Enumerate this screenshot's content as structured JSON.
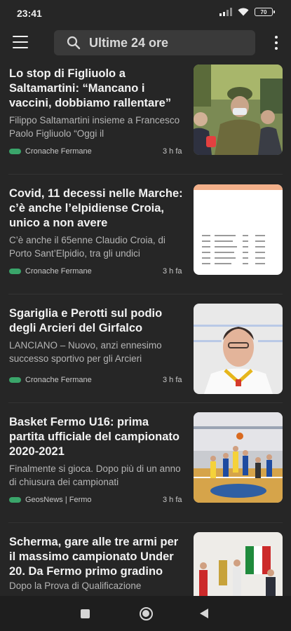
{
  "status_bar": {
    "time": "23:41",
    "battery": "70"
  },
  "search": {
    "text": "Ultime 24 ore"
  },
  "articles": [
    {
      "title": "Lo stop di Figliuolo a Saltamartini: “Mancano i vaccini, dobbiamo rallentare”",
      "snippet": "  Filippo Saltamartini insieme a Francesco Paolo Figliuolo   “Oggi il",
      "source": "Cronache Fermane",
      "time": "3 h fa"
    },
    {
      "title": "Covid, 11 decessi nelle Marche: c’è anche l’elpidiense Croia, unico a non avere",
      "snippet": "C’è anche il 65enne Claudio Croia, di Porto Sant’Elpidio, tra gli undici",
      "source": "Cronache Fermane",
      "time": "3 h fa"
    },
    {
      "title": "Sgariglia e Perotti sul podio degli Arcieri del Girfalco",
      "snippet": "LANCIANO – Nuovo, anzi ennesimo successo sportivo per gli Arcieri",
      "source": "Cronache Fermane",
      "time": "3 h fa"
    },
    {
      "title": "Basket Fermo U16: prima partita ufficiale del campionato 2020-2021",
      "snippet": "Finalmente si gioca. Dopo più di un anno di chiusura dei campionati",
      "source": "GeosNews | Fermo",
      "time": "3 h fa"
    },
    {
      "title": "Scherma, gare alle tre armi per il massimo campionato Under 20. Da Fermo primo gradino",
      "snippet": "Dopo la Prova di Qualificazione",
      "source": "",
      "time": ""
    }
  ],
  "colors": {
    "background": "#262626",
    "source_badge": "#3aa56a",
    "search_bg": "#3a3a3a"
  },
  "icons": [
    "menu-icon",
    "search-icon",
    "more-vert-icon",
    "wifi-icon",
    "signal-icon",
    "battery-icon",
    "nav-recents-icon",
    "nav-home-icon",
    "nav-back-icon"
  ]
}
